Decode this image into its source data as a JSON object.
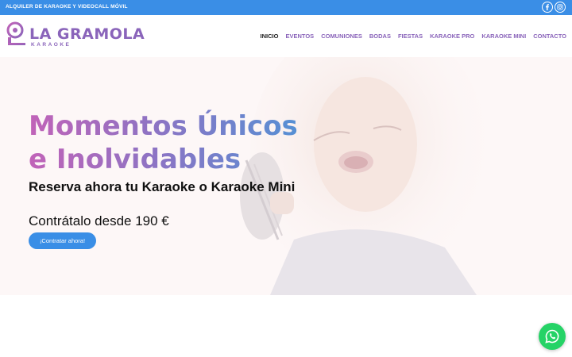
{
  "topbar": {
    "tagline": "ALQUILER DE KARAOKE Y VIDEOCALL MÓVIL",
    "social": [
      "facebook-icon",
      "instagram-icon"
    ]
  },
  "logo": {
    "name": "LA GRAMOLA",
    "subtitle": "KARAOKE"
  },
  "nav": {
    "items": [
      {
        "label": "INICIO",
        "active": true
      },
      {
        "label": "EVENTOS"
      },
      {
        "label": "COMUNIONES"
      },
      {
        "label": "BODAS"
      },
      {
        "label": "FIESTAS"
      },
      {
        "label": "KARAOKE PRO"
      },
      {
        "label": "KARAOKE MINI"
      },
      {
        "label": "CONTACTO"
      }
    ]
  },
  "hero": {
    "title_line1": "Momentos Únicos",
    "title_line2": "e Inolvidables",
    "subtitle": "Reserva ahora tu Karaoke o Karaoke Mini",
    "price": "Contrátalo desde 190  €",
    "cta_label": "¡Contratar ahora!"
  },
  "colors": {
    "accent_blue": "#3a8ee6",
    "brand_purple": "#8a64ba",
    "whatsapp_green": "#25d366"
  }
}
